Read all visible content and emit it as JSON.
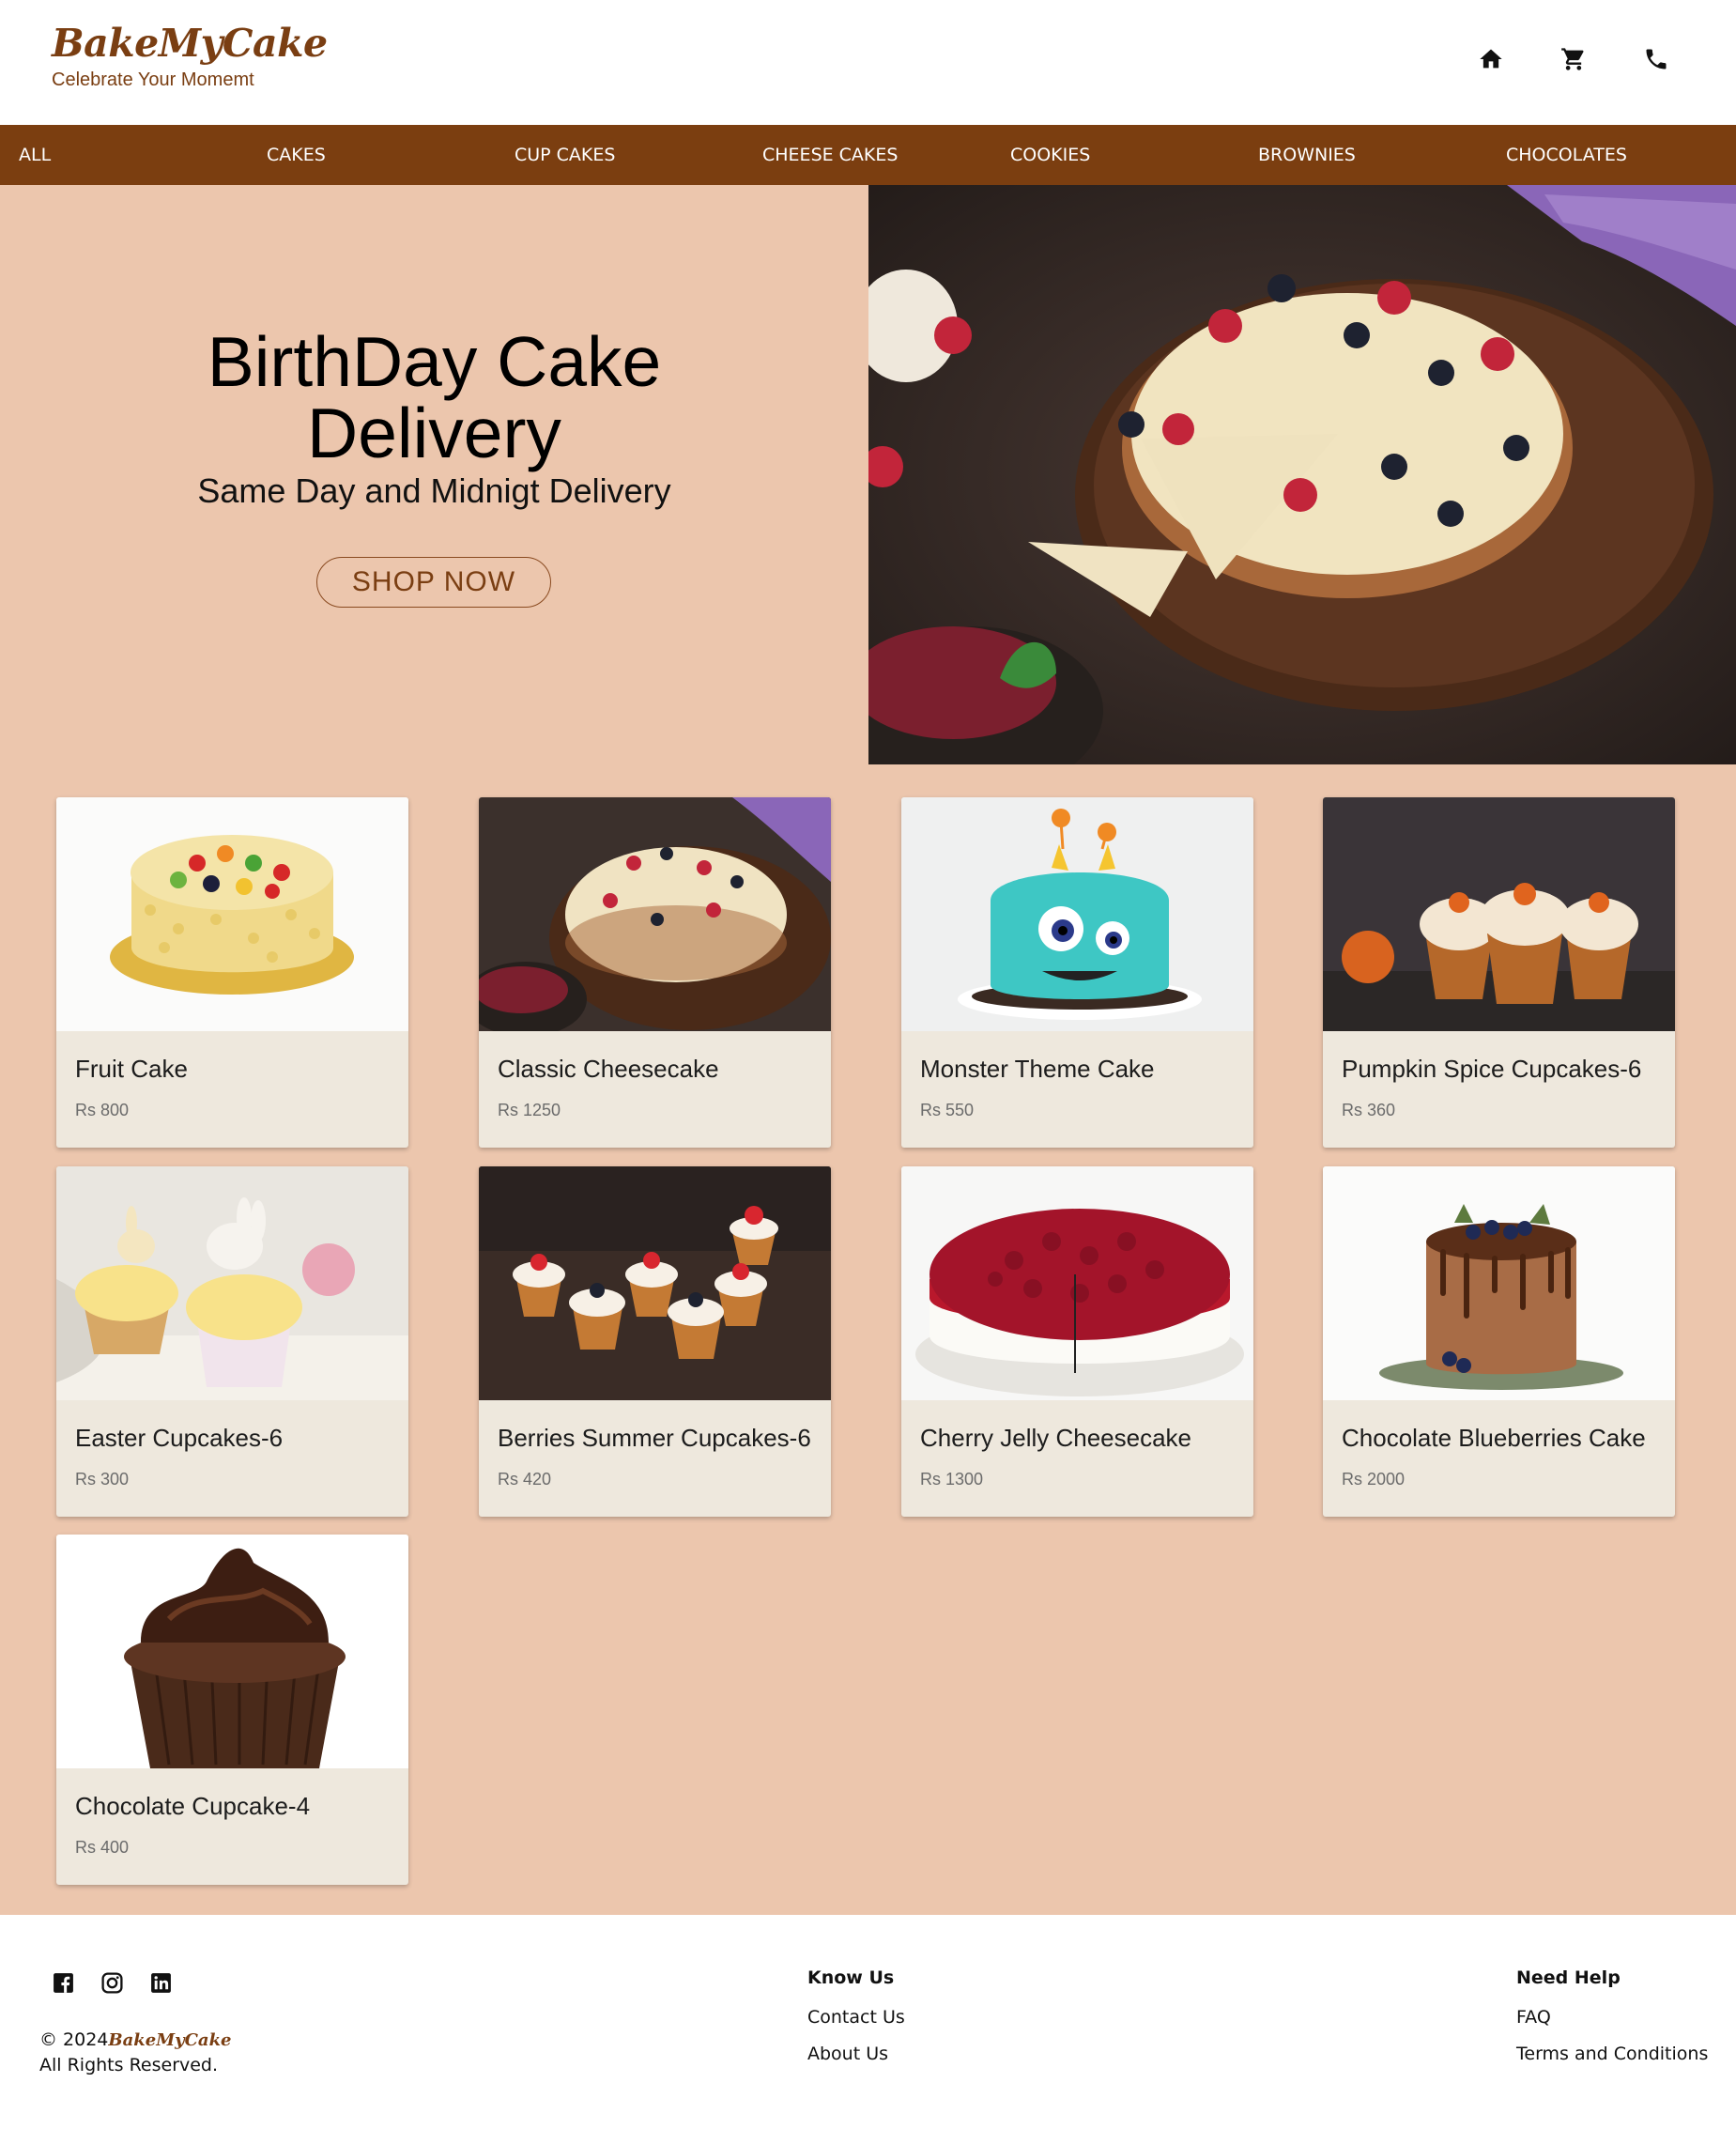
{
  "header": {
    "logo": "BakeMyCake",
    "tagline": "Celebrate Your Momemt",
    "icons": [
      "home-icon",
      "cart-icon",
      "phone-icon"
    ]
  },
  "nav": {
    "items": [
      "ALL",
      "CAKES",
      "CUP CAKES",
      "CHEESE CAKES",
      "COOKIES",
      "BROWNIES",
      "CHOCOLATES"
    ]
  },
  "hero": {
    "title_line1": "BirthDay Cake",
    "title_line2": "Delivery",
    "subtitle": "Same Day and Midnigt Delivery",
    "button": "SHOP NOW"
  },
  "products": [
    {
      "name": "Fruit Cake",
      "price": "Rs 800"
    },
    {
      "name": "Classic Cheesecake",
      "price": "Rs 1250"
    },
    {
      "name": "Monster Theme Cake",
      "price": "Rs 550"
    },
    {
      "name": "Pumpkin Spice Cupcakes-6",
      "price": "Rs 360"
    },
    {
      "name": "Easter Cupcakes-6",
      "price": "Rs 300"
    },
    {
      "name": "Berries Summer Cupcakes-6",
      "price": "Rs 420"
    },
    {
      "name": "Cherry Jelly Cheesecake",
      "price": "Rs 1300"
    },
    {
      "name": "Chocolate Blueberries Cake",
      "price": "Rs 2000"
    },
    {
      "name": "Chocolate Cupcake-4",
      "price": "Rs 400"
    }
  ],
  "footer": {
    "social": [
      "facebook-icon",
      "instagram-icon",
      "linkedin-icon"
    ],
    "copyright_prefix": "© 2024",
    "copyright_brand": "BakeMyCake",
    "rights": "All Rights Reserved.",
    "know_us": {
      "heading": "Know Us",
      "links": [
        "Contact Us",
        "About Us"
      ]
    },
    "need_help": {
      "heading": "Need Help",
      "links": [
        "FAQ",
        "Terms and Conditions"
      ]
    }
  },
  "colors": {
    "brand": "#7b3e10",
    "background": "#ecc6ad",
    "card": "#eee8dd"
  }
}
